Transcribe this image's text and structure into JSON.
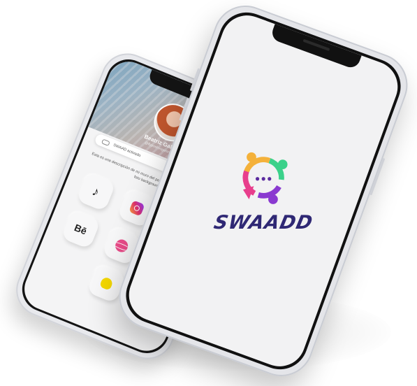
{
  "back_phone": {
    "profile": {
      "name": "Beatriz Galdón",
      "username": "@flyposhvogelon.com"
    },
    "status_text": "SWAAD activado",
    "description": "Esta es una descripción de mi muro del perfil que en lo donde se verá mi foto background.",
    "apps": [
      {
        "name": "tiktok",
        "label": "♪"
      },
      {
        "name": "instagram",
        "label": ""
      },
      {
        "name": "spotify",
        "label": ""
      },
      {
        "name": "behance",
        "label": "Bē"
      },
      {
        "name": "dribbble",
        "label": ""
      },
      {
        "name": "snapchat",
        "label": ""
      }
    ]
  },
  "front_phone": {
    "brand": "SWAADD",
    "logo_colors": [
      "#f4b13a",
      "#e83e8c",
      "#8a3ad0",
      "#35b6d6",
      "#3bd18a",
      "#5a2a9e"
    ]
  }
}
